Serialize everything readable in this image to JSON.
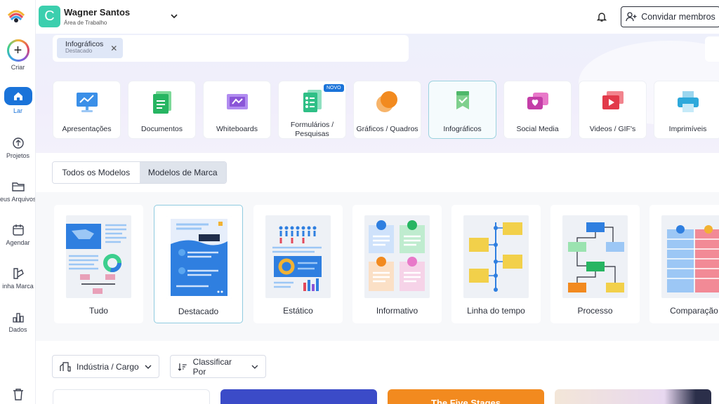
{
  "sidebar": {
    "items": [
      {
        "label": "Criar",
        "icon": "plus-icon"
      },
      {
        "label": "Lar",
        "icon": "home-icon"
      },
      {
        "label": "Projetos",
        "icon": "projects-icon"
      },
      {
        "label": "eus Arquivos",
        "icon": "folder-icon"
      },
      {
        "label": "Agendar",
        "icon": "calendar-icon"
      },
      {
        "label": "inha Marca",
        "icon": "brand-icon"
      },
      {
        "label": "Dados",
        "icon": "data-icon"
      },
      {
        "label": "",
        "icon": "trash-icon"
      }
    ]
  },
  "header": {
    "avatar_letter": "C",
    "workspace_name": "Wagner Santos",
    "workspace_sub": "Área de Trabalho",
    "invite_label": "Convidar membros"
  },
  "filter": {
    "chip_title": "Infográficos",
    "chip_sub": "Destacado"
  },
  "categories": [
    {
      "label": "Apresentações",
      "icon": "presentation-icon"
    },
    {
      "label": "Documentos",
      "icon": "document-icon"
    },
    {
      "label": "Whiteboards",
      "icon": "whiteboard-icon"
    },
    {
      "label": "Formulários / Pesquisas",
      "icon": "forms-icon",
      "badge": "NOVO"
    },
    {
      "label": "Gráficos / Quadros",
      "icon": "charts-icon"
    },
    {
      "label": "Infográficos",
      "icon": "infographic-icon"
    },
    {
      "label": "Social Media",
      "icon": "social-media-icon"
    },
    {
      "label": "Videos / GIF's",
      "icon": "video-icon"
    },
    {
      "label": "Imprimíveis",
      "icon": "printer-icon"
    }
  ],
  "template_toggle": {
    "all": "Todos os Modelos",
    "brand": "Modelos de Marca"
  },
  "types": [
    {
      "label": "Tudo"
    },
    {
      "label": "Destacado"
    },
    {
      "label": "Estático"
    },
    {
      "label": "Informativo"
    },
    {
      "label": "Linha do tempo"
    },
    {
      "label": "Processo"
    },
    {
      "label": "Comparação"
    }
  ],
  "dropdowns": {
    "industry": "Indústria / Cargo",
    "sort": "Classificar Por"
  },
  "bottom_cards": {
    "third_text": "The Five Stages"
  },
  "colors": {
    "accent": "#1a73d9",
    "workspace_avatar": "#3ccfae"
  }
}
